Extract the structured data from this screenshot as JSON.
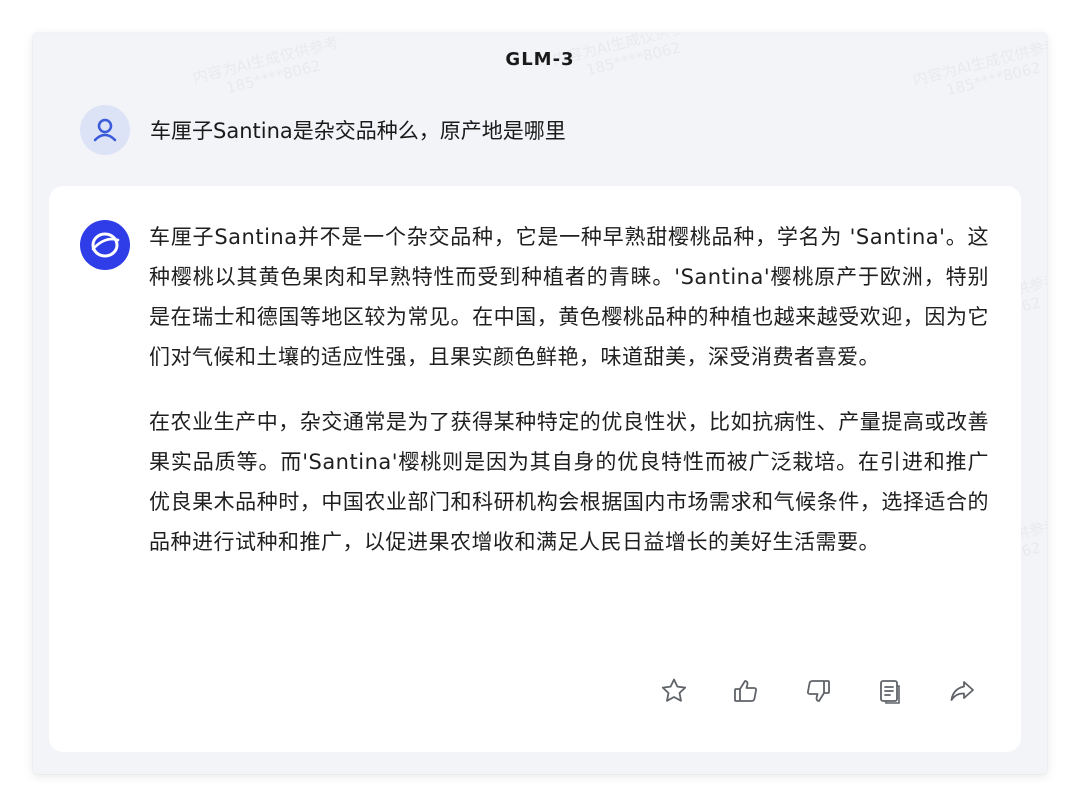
{
  "header": {
    "model_name": "GLM-3"
  },
  "watermark": {
    "line1": "内容为AI生成仅供参考",
    "line2": "185****8062"
  },
  "conversation": {
    "user_message": "车厘子Santina是杂交品种么，原产地是哪里",
    "assistant_paragraphs": [
      "车厘子Santina并不是一个杂交品种，它是一种早熟甜樱桃品种，学名为 'Santina'。这种樱桃以其黄色果肉和早熟特性而受到种植者的青睐。'Santina'樱桃原产于欧洲，特别是在瑞士和德国等地区较为常见。在中国，黄色樱桃品种的种植也越来越受欢迎，因为它们对气候和土壤的适应性强，且果实颜色鲜艳，味道甜美，深受消费者喜爱。",
      "在农业生产中，杂交通常是为了获得某种特定的优良性状，比如抗病性、产量提高或改善果实品质等。而'Santina'樱桃则是因为其自身的优良特性而被广泛栽培。在引进和推广优良果木品种时，中国农业部门和科研机构会根据国内市场需求和气候条件，选择适合的品种进行试种和推广，以促进果农增收和满足人民日益增长的美好生活需要。"
    ]
  },
  "actions": [
    {
      "name": "favorite",
      "icon": "star-icon"
    },
    {
      "name": "like",
      "icon": "thumbs-up-icon"
    },
    {
      "name": "dislike",
      "icon": "thumbs-down-icon"
    },
    {
      "name": "copy",
      "icon": "copy-icon"
    },
    {
      "name": "share",
      "icon": "share-icon"
    }
  ],
  "colors": {
    "bot_avatar": "#2f3de8",
    "user_avatar_bg": "#dde3f7",
    "user_avatar_icon": "#3b5bdb",
    "icon_gray": "#5f6368"
  }
}
